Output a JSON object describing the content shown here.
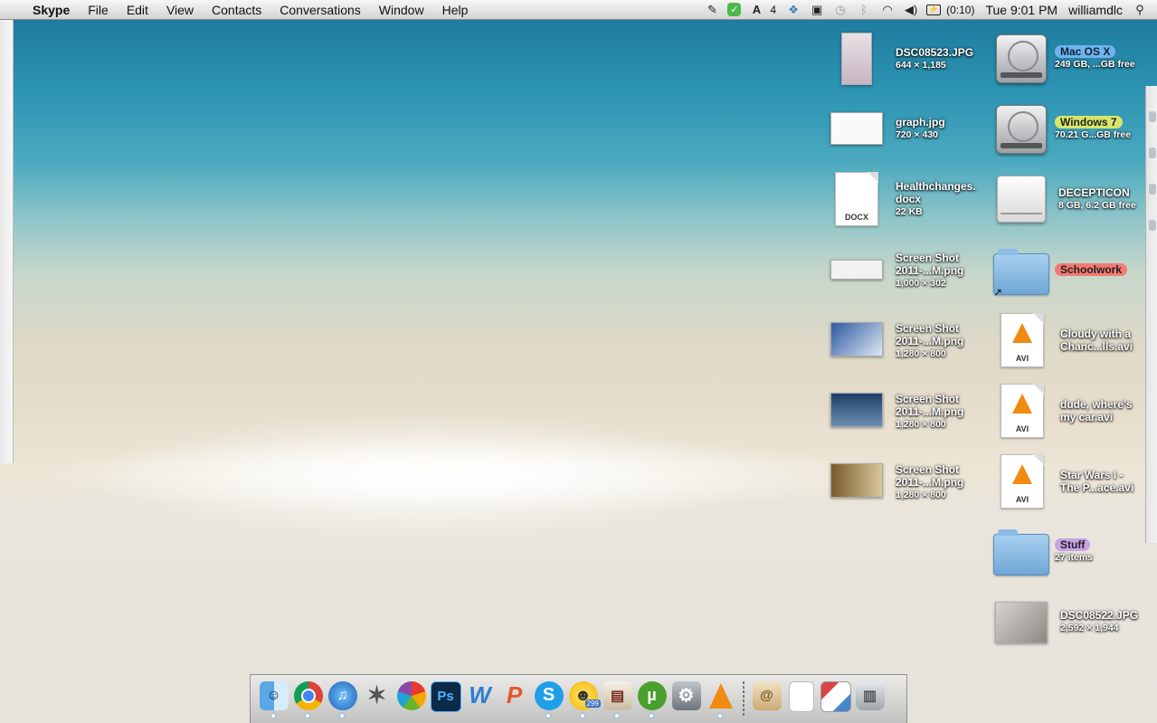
{
  "menubar": {
    "app_name": "Skype",
    "menus": [
      "File",
      "Edit",
      "View",
      "Contacts",
      "Conversations",
      "Window",
      "Help"
    ],
    "status": {
      "notification_count": "4",
      "battery_time": "(0:10)",
      "clock": "Tue 9:01 PM",
      "user": "williamdlc"
    }
  },
  "desktop": {
    "files": [
      {
        "name": "DSC08523.JPG",
        "info": "644 × 1,185"
      },
      {
        "name": "graph.jpg",
        "info": "720 × 430"
      },
      {
        "name": "Healthchanges.\ndocx",
        "line1": "Healthchanges.",
        "line2": "docx",
        "info": "22 KB",
        "ext": "DOCX"
      },
      {
        "line1": "Screen Shot",
        "line2": "2011-...M.png",
        "info": "1,000 × 302"
      },
      {
        "line1": "Screen Shot",
        "line2": "2011-...M.png",
        "info": "1,280 × 800"
      },
      {
        "line1": "Screen Shot",
        "line2": "2011-...M.png",
        "info": "1,280 × 800"
      },
      {
        "line1": "Screen Shot",
        "line2": "2011-...M.png",
        "info": "1,280 × 800"
      }
    ],
    "volumes": [
      {
        "name": "Mac OS X",
        "info": "249 GB, ...GB free"
      },
      {
        "name": "Windows 7",
        "info": "70.21 G...GB free"
      },
      {
        "name": "DECEPTICON",
        "info": "8 GB, 6.2 GB free"
      }
    ],
    "schoolwork": {
      "name": "Schoolwork"
    },
    "videos": [
      {
        "line1": "Cloudy with a",
        "line2": "Chanc...lls.avi",
        "ext": "AVI"
      },
      {
        "line1": "dude, where's",
        "line2": "my car.avi",
        "ext": "AVI"
      },
      {
        "line1": "Star Wars I -",
        "line2": "The P...ace.avi",
        "ext": "AVI"
      }
    ],
    "stuff": {
      "name": "Stuff",
      "info": "27 items"
    },
    "photo2": {
      "name": "DSC08522.JPG",
      "info": "2,592 × 1,944"
    }
  },
  "dock": {
    "badge_yahoo": "299",
    "items": [
      "finder-icon",
      "chrome-icon",
      "itunes-icon",
      "imovie-icon",
      "picasa-icon",
      "photoshop-icon",
      "word-icon",
      "powerpoint-icon",
      "skype-icon",
      "yahoo-messenger-icon",
      "dictionary-icon",
      "utorrent-icon",
      "system-preferences-icon",
      "vlc-icon"
    ]
  }
}
